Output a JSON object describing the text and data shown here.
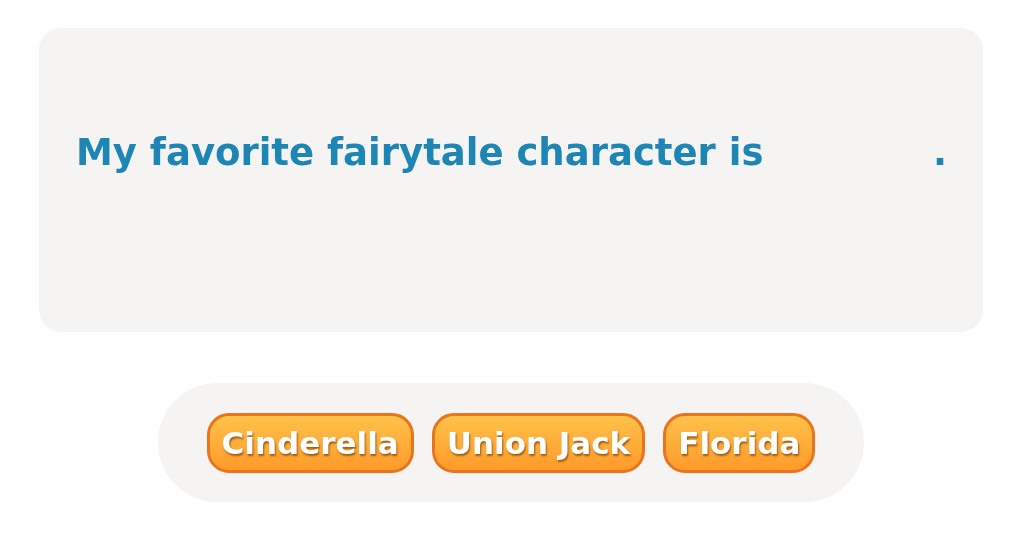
{
  "sentence": {
    "before": "My favorite fairytale character is",
    "after": "."
  },
  "options": [
    {
      "label": "Cinderella"
    },
    {
      "label": "Union Jack"
    },
    {
      "label": "Florida"
    }
  ]
}
